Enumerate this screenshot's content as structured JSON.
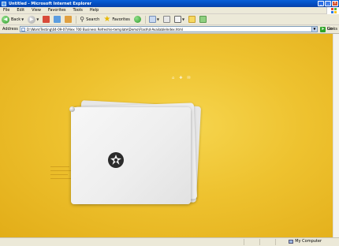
{
  "window": {
    "title": "Untitled - Microsoft Internet Explorer",
    "controls": [
      "_",
      "□",
      "×"
    ]
  },
  "menu": [
    "File",
    "Edit",
    "View",
    "Favorites",
    "Tools",
    "Help"
  ],
  "toolbar": {
    "back_label": "Back",
    "search_label": "Search",
    "favorites_label": "Favorites"
  },
  "address": {
    "label": "Address",
    "url": "D:\\Work\\Testing\\04-09-07\\Alex 700 Business Refresh\\e-template\\Demo\\Flash\\d-AvailableIndex.html",
    "go_label": "Go",
    "links_label": "Links"
  },
  "content": {
    "background": "#eec22f",
    "mini_icons": [
      "home-icon",
      "plus-icon",
      "mail-icon"
    ]
  },
  "status": {
    "zone_label": "My Computer"
  }
}
